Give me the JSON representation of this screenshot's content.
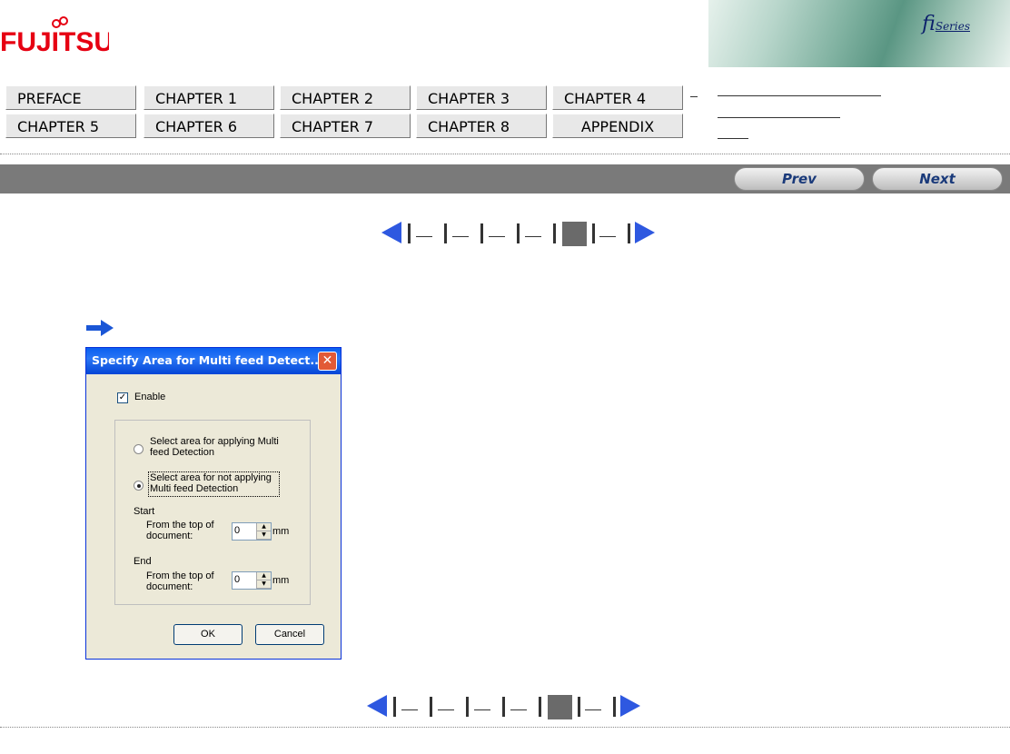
{
  "brand": {
    "logo_text": "FUJITSU",
    "banner_text": "fi",
    "banner_sub": "Series"
  },
  "chapters": [
    "PREFACE",
    "CHAPTER 1",
    "CHAPTER 2",
    "CHAPTER 3",
    "CHAPTER 4",
    "CHAPTER 5",
    "CHAPTER 6",
    "CHAPTER 7",
    "CHAPTER 8",
    "APPENDIX"
  ],
  "nav": {
    "prev": "Prev",
    "next": "Next"
  },
  "dialog": {
    "title": "Specify Area for Multi feed Detect...",
    "enable_label": "Enable",
    "enable_checked": true,
    "radio1_line1": "Select area for applying Multi",
    "radio1_line2": "feed Detection",
    "radio2_line1": "Select area for not applying",
    "radio2_line2": "Multi feed Detection",
    "selected_radio": 2,
    "start_label": "Start",
    "end_label": "End",
    "from_top_line1": "From the top of",
    "from_top_line2": "document:",
    "start_value": "0",
    "end_value": "0",
    "unit": "mm",
    "ok_label": "OK",
    "cancel_label": "Cancel"
  }
}
